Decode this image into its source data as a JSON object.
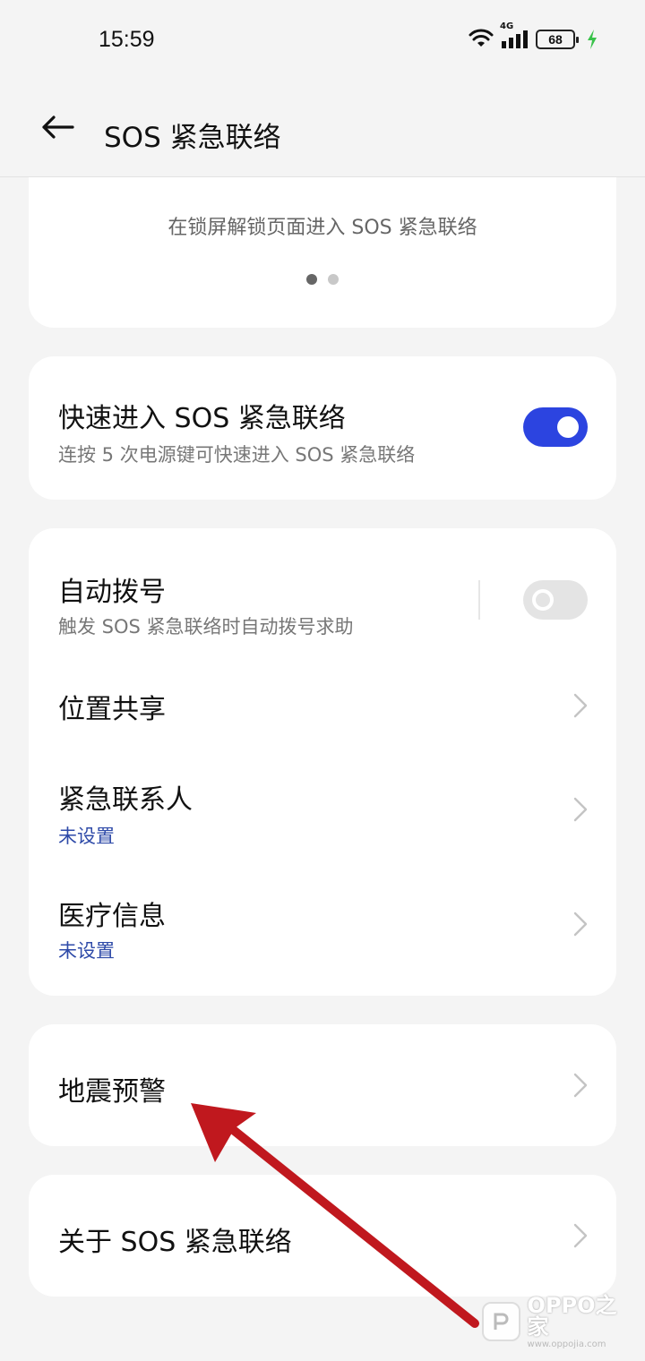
{
  "status": {
    "time": "15:59",
    "network": "4G",
    "battery": "68"
  },
  "header": {
    "title": "SOS 紧急联络"
  },
  "intro": {
    "text": "在锁屏解锁页面进入 SOS 紧急联络",
    "dots_total": 2,
    "dots_active_index": 0
  },
  "quick_entry": {
    "title": "快速进入 SOS 紧急联络",
    "subtitle": "连按 5 次电源键可快速进入 SOS 紧急联络",
    "enabled": true
  },
  "settings": {
    "auto_dial": {
      "title": "自动拨号",
      "subtitle": "触发 SOS 紧急联络时自动拨号求助",
      "enabled": false
    },
    "location": {
      "title": "位置共享"
    },
    "contacts": {
      "title": "紧急联系人",
      "value": "未设置"
    },
    "medical": {
      "title": "医疗信息",
      "value": "未设置"
    }
  },
  "earthquake": {
    "title": "地震预警"
  },
  "about": {
    "title": "关于 SOS 紧急联络"
  },
  "watermark": {
    "brand": "OPPO之家",
    "url": "www.oppojia.com"
  },
  "colors": {
    "accent": "#2c44e0",
    "link": "#2e4aa8",
    "annotation_arrow": "#c0181e",
    "background": "#f4f4f4"
  }
}
